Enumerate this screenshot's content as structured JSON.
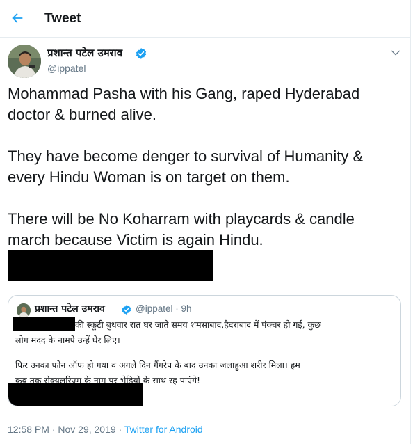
{
  "header": {
    "title": "Tweet",
    "back_icon": "back-arrow-icon"
  },
  "tweet": {
    "author_name": "प्रशान्त पटेल उमराव",
    "author_handle": "@ippatel",
    "verified_icon": "verified-badge-icon",
    "menu_icon": "chevron-down-icon",
    "lines": [
      "Mohammad Pasha with his Gang, raped Hyderabad",
      "doctor & burned alive.",
      "They have become denger to survival of Humanity &",
      "every Hindu Woman is on target on them.",
      "There will be No Koharram with playcards & candle",
      "march because Victim is again Hindu."
    ]
  },
  "quoted": {
    "author_name": "प्रशान्त पटेल उमराव",
    "author_handle": "@ippatel",
    "time_ago": "· 9h",
    "lines": [
      "की स्कूटी बुधवार रात घर जाते समय शमसाबाद,हैदराबाद में पंक्चर हो गई, कुछ",
      "लोग मदद के नामपे उन्हें घेर लिए।",
      "फिर उनका फोन ऑफ हो गया व अगले दिन गैंगरेप के बाद उनका जलाहुआ शरीर मिला। हम",
      "कब तक सेक्युलरिज्म के नाम पर भेड़ियों के साथ रह पाएंगे!"
    ]
  },
  "meta": {
    "timestamp": "12:58 PM · Nov 29, 2019 · ",
    "source": "Twitter for Android"
  },
  "colors": {
    "accent": "#1da1f2",
    "text": "#14171a",
    "secondary_text": "#657786",
    "border": "#e6ecf0",
    "redaction": "#000000"
  }
}
